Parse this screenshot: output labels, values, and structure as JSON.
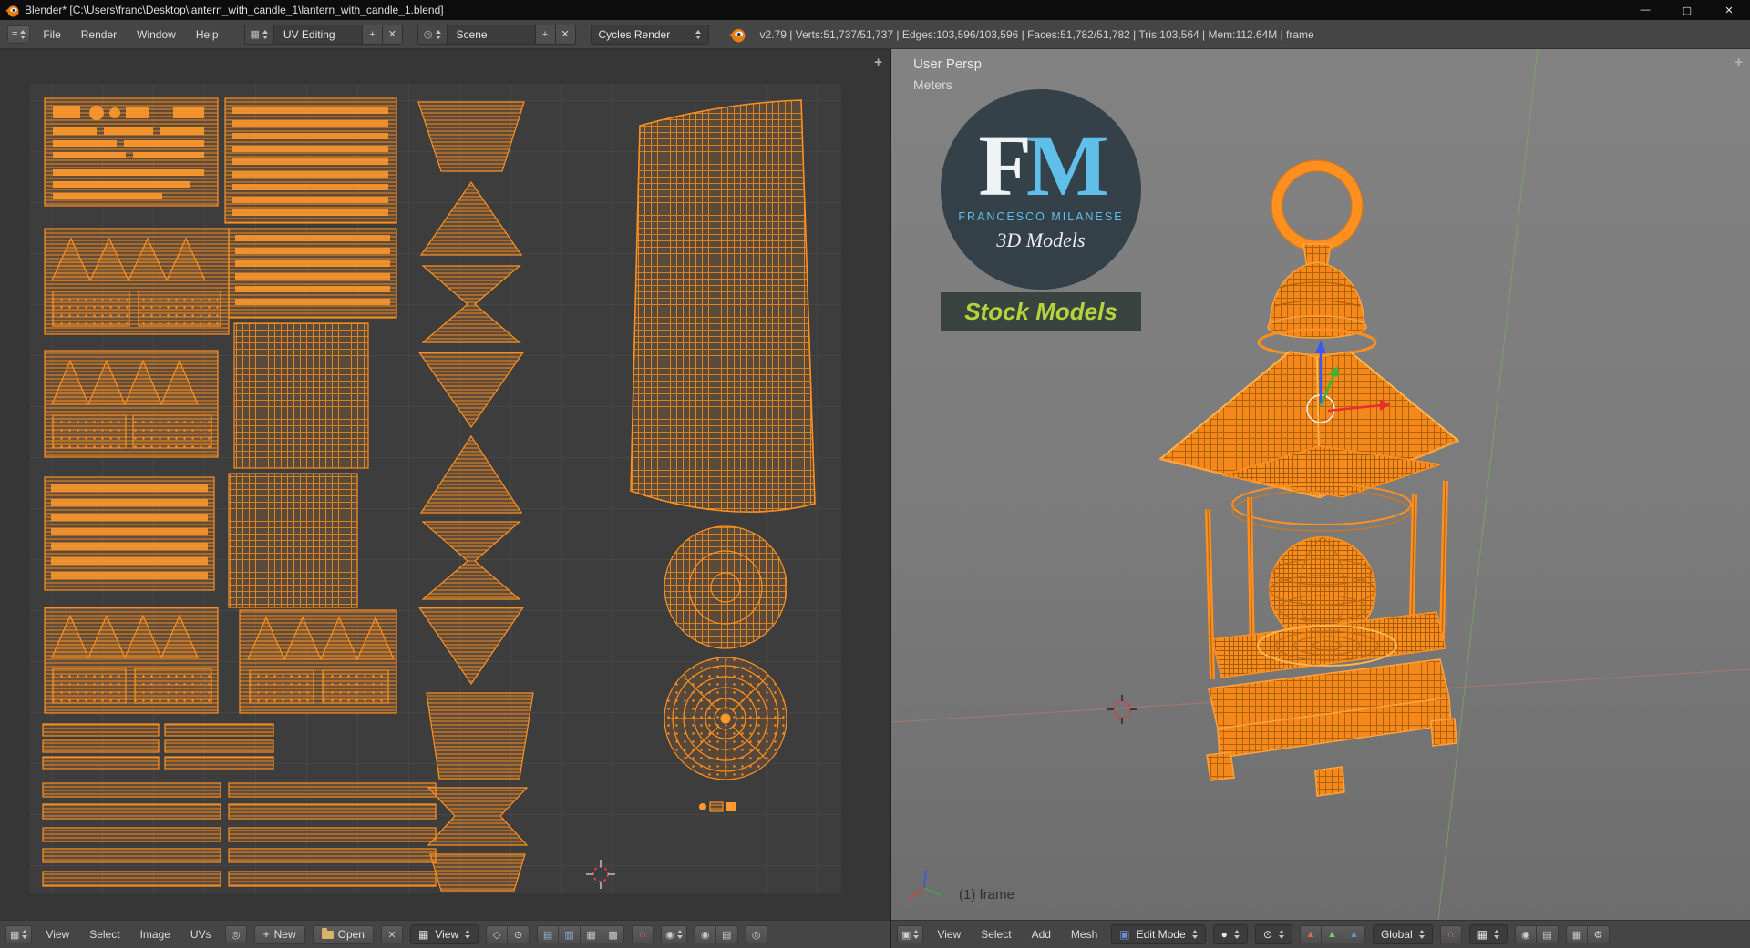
{
  "window": {
    "title": "Blender* [C:\\Users\\franc\\Desktop\\lantern_with_candle_1\\lantern_with_candle_1.blend]"
  },
  "icons": {
    "minimize": "—",
    "maximize": "▢",
    "close": "✕",
    "plus": "+",
    "x": "✕",
    "menu_lines": "≡",
    "image": "▦",
    "pin": "◎",
    "sync": "◇",
    "mode_a": "▤",
    "mode_b": "▥",
    "mode_c": "▦",
    "mode_d": "▩",
    "magnet": "∩",
    "proportional": "◉",
    "snap_elem": "▦",
    "globe": "◎",
    "cube": "▣",
    "sphere": "●",
    "pivot": "⊙",
    "manip": "▲",
    "camera": "◉",
    "layers": "▤",
    "wrench": "⚙"
  },
  "infobar": {
    "menus": [
      "File",
      "Render",
      "Window",
      "Help"
    ],
    "screen_layout": "UV Editing",
    "scene": "Scene",
    "engine": "Cycles Render",
    "stats": "v2.79 | Verts:51,737/51,737 | Edges:103,596/103,596 | Faces:51,782/51,782 | Tris:103,564 | Mem:112.64M | frame"
  },
  "uv_editor": {
    "header": {
      "menus": [
        "View",
        "Select",
        "Image",
        "UVs"
      ],
      "new_button": "New",
      "open_button": "Open",
      "view_dropdown": "View"
    }
  },
  "viewport": {
    "overlay": {
      "perspective": "User Persp",
      "units": "Meters",
      "frame_info": "(1) frame"
    },
    "watermark": {
      "letter_f": "F",
      "letter_m": "M",
      "studio": "FRANCESCO MILANESE",
      "tagline": "3D Models",
      "banner": "Stock Models"
    },
    "header": {
      "menus": [
        "View",
        "Select",
        "Add",
        "Mesh"
      ],
      "mode": "Edit Mode",
      "orientation": "Global"
    }
  },
  "colors": {
    "accent_orange": "#ff9020",
    "wire_dark": "#c06a10",
    "uv_background": "#3d3d3d",
    "header_background": "#454545",
    "viewport_gray": "#7b7b7b",
    "logo_blue": "#5fbfe8",
    "banner_green": "#b5d33a",
    "axis_red": "#e03030",
    "axis_green": "#38b838",
    "axis_blue": "#3858f8"
  }
}
